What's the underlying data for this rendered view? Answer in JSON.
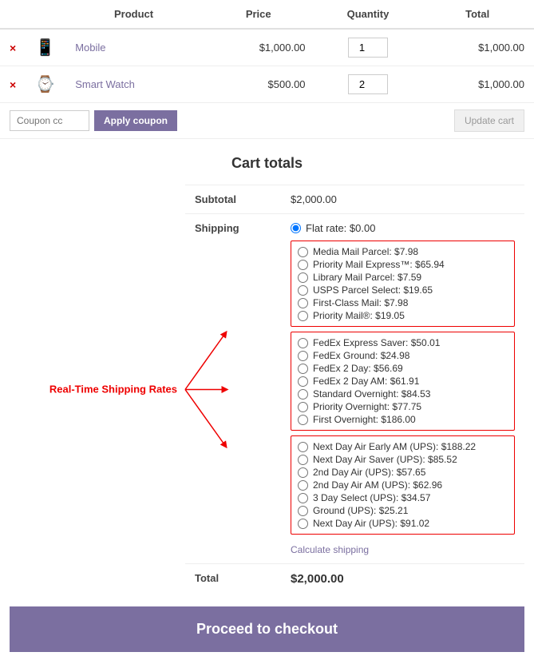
{
  "table": {
    "headers": [
      "",
      "",
      "Product",
      "Price",
      "Quantity",
      "Total"
    ],
    "rows": [
      {
        "remove": "×",
        "icon": "📱",
        "product": "Mobile",
        "price": "$1,000.00",
        "quantity": "1",
        "total": "$1,000.00"
      },
      {
        "remove": "×",
        "icon": "⌚",
        "product": "Smart Watch",
        "price": "$500.00",
        "quantity": "2",
        "total": "$1,000.00"
      }
    ]
  },
  "coupon": {
    "placeholder": "Coupon cc",
    "apply_label": "Apply coupon",
    "update_label": "Update cart"
  },
  "cart_totals": {
    "title": "Cart totals",
    "subtotal_label": "Subtotal",
    "subtotal_value": "$2,000.00",
    "shipping_label": "Shipping",
    "flat_rate_label": "Flat rate: $0.00",
    "annotation_label": "Real-Time Shipping Rates",
    "usps_group": [
      "Media Mail Parcel: $7.98",
      "Priority Mail Express™: $65.94",
      "Library Mail Parcel: $7.59",
      "USPS Parcel Select: $19.65",
      "First-Class Mail: $7.98",
      "Priority Mail®: $19.05"
    ],
    "fedex_group": [
      "FedEx Express Saver: $50.01",
      "FedEx Ground: $24.98",
      "FedEx 2 Day: $56.69",
      "FedEx 2 Day AM: $61.91",
      "Standard Overnight: $84.53",
      "Priority Overnight: $77.75",
      "First Overnight: $186.00"
    ],
    "ups_group": [
      "Next Day Air Early AM (UPS): $188.22",
      "Next Day Air Saver (UPS): $85.52",
      "2nd Day Air (UPS): $57.65",
      "2nd Day Air AM (UPS): $62.96",
      "3 Day Select (UPS): $34.57",
      "Ground (UPS): $25.21",
      "Next Day Air (UPS): $91.02"
    ],
    "calculate_shipping": "Calculate shipping",
    "total_label": "Total",
    "total_value": "$2,000.00",
    "proceed_label": "Proceed to checkout"
  }
}
